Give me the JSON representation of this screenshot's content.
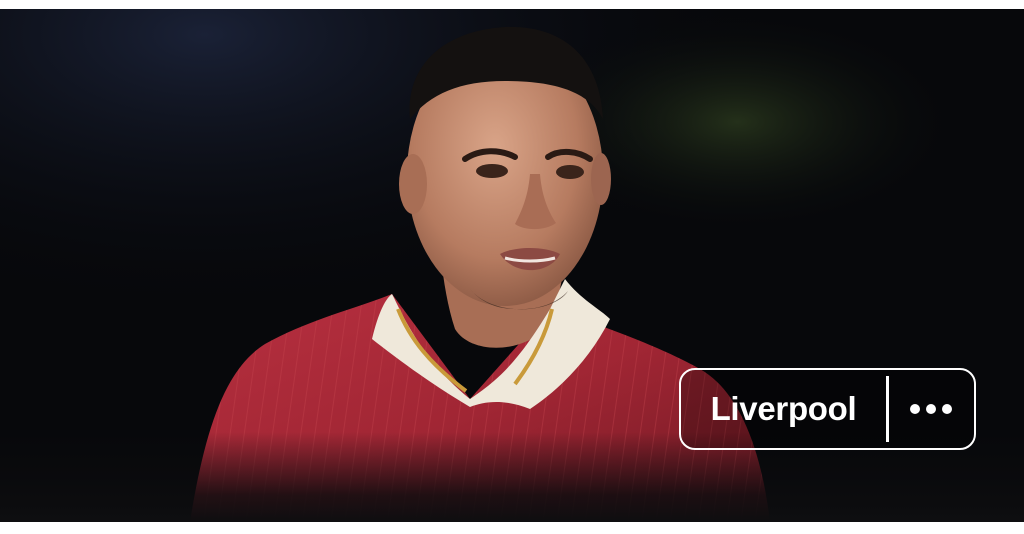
{
  "card": {
    "image_description_icon": "player-photo",
    "team_chip": {
      "label": "Liverpool",
      "more_icon": "more-horizontal-icon"
    }
  },
  "colors": {
    "background": "#07080b",
    "shirt_red": "#a52330",
    "chip_border": "#ffffff"
  }
}
